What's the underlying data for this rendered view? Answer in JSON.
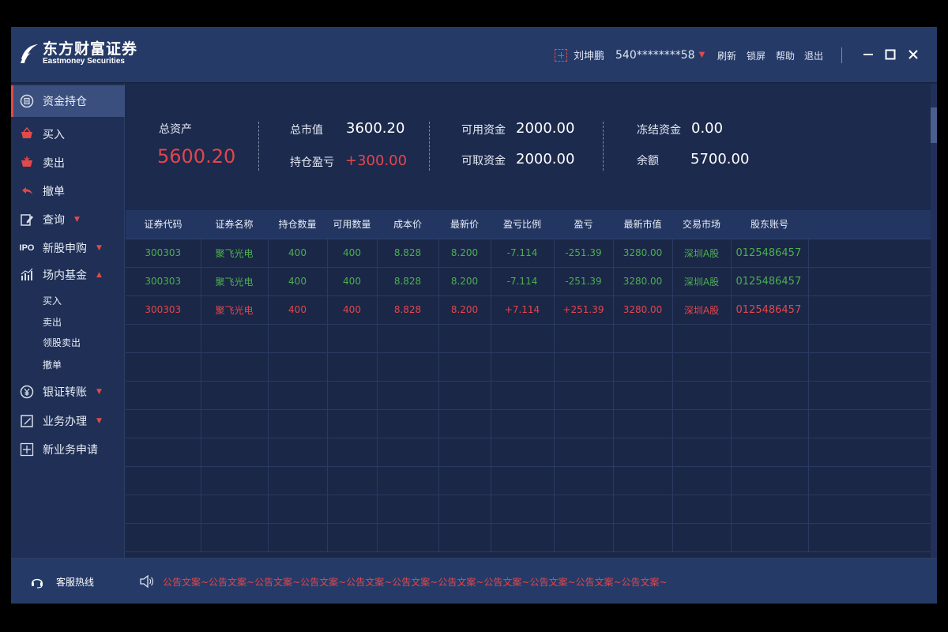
{
  "brand": {
    "name_cn": "东方财富证券",
    "name_en": "Eastmoney Securities"
  },
  "header": {
    "user_name": "刘坤鹏",
    "account": "540********58",
    "links": [
      "刷新",
      "锁屏",
      "帮助",
      "退出"
    ]
  },
  "sidebar": {
    "items": [
      {
        "label": "资金持仓",
        "icon": "wallet-icon"
      },
      {
        "label": "买入",
        "icon": "buy-basket-icon"
      },
      {
        "label": "卖出",
        "icon": "sell-basket-icon"
      },
      {
        "label": "撤单",
        "icon": "undo-icon"
      },
      {
        "label": "查询",
        "icon": "edit-query-icon"
      },
      {
        "label": "新股申购",
        "icon": "ipo-icon"
      },
      {
        "label": "场内基金",
        "icon": "bar-chart-icon"
      },
      {
        "label": "银证转账",
        "icon": "yen-icon"
      },
      {
        "label": "业务办理",
        "icon": "edit-icon"
      },
      {
        "label": "新业务申请",
        "icon": "plus-box-icon"
      }
    ],
    "fund_sub": [
      "买入",
      "卖出",
      "领股卖出",
      "撤单"
    ]
  },
  "summary": {
    "total_assets_label": "总资产",
    "total_assets": "5600.20",
    "market_value_label": "总市值",
    "market_value": "3600.20",
    "position_pnl_label": "持仓盈亏",
    "position_pnl": "+300.00",
    "available_label": "可用资金",
    "available": "2000.00",
    "withdrawable_label": "可取资金",
    "withdrawable": "2000.00",
    "frozen_label": "冻结资金",
    "frozen": "0.00",
    "balance_label": "余额",
    "balance": "5700.00"
  },
  "table": {
    "headers": [
      "证券代码",
      "证券名称",
      "持仓数量",
      "可用数量",
      "成本价",
      "最新价",
      "盈亏比例",
      "盈亏",
      "最新市值",
      "交易市场",
      "股东账号",
      ""
    ],
    "rows": [
      {
        "color": "green",
        "cells": [
          "300303",
          "聚飞光电",
          "400",
          "400",
          "8.828",
          "8.200",
          "-7.114",
          "-251.39",
          "3280.00",
          "深圳A股",
          "0125486457",
          ""
        ]
      },
      {
        "color": "green",
        "cells": [
          "300303",
          "聚飞光电",
          "400",
          "400",
          "8.828",
          "8.200",
          "-7.114",
          "-251.39",
          "3280.00",
          "深圳A股",
          "0125486457",
          ""
        ]
      },
      {
        "color": "red",
        "cells": [
          "300303",
          "聚飞光电",
          "400",
          "400",
          "8.828",
          "8.200",
          "+7.114",
          "+251.39",
          "3280.00",
          "深圳A股",
          "0125486457",
          ""
        ]
      }
    ],
    "empty_rows": 8
  },
  "footer": {
    "hotline": "客服热线",
    "notice": "公告文案~公告文案~公告文案~公告文案~公告文案~公告文案~公告文案~公告文案~公告文案~公告文案~公告文案~"
  },
  "colors": {
    "accent_red": "#e3464c",
    "gain_green": "#4caf50",
    "bg": "#1a2747",
    "header_bg": "#253a67"
  }
}
